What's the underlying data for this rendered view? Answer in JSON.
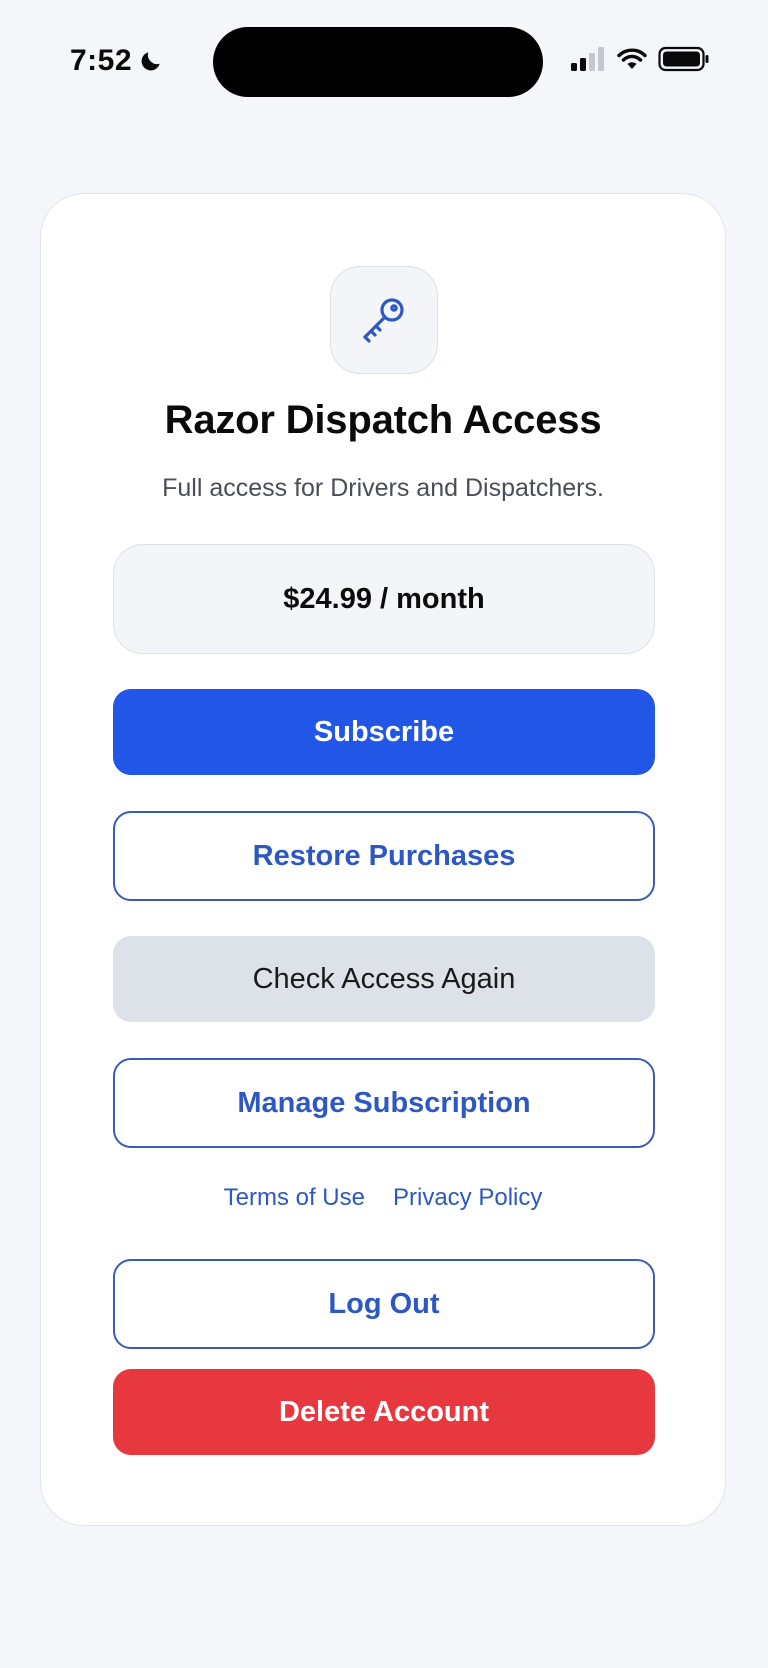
{
  "status_bar": {
    "time": "7:52",
    "icons": [
      "moon-icon",
      "signal-icon",
      "wifi-icon",
      "battery-icon"
    ]
  },
  "card": {
    "icon": "key-icon",
    "title": "Razor Dispatch Access",
    "subtitle": "Full access for Drivers and Dispatchers.",
    "price": "$24.99 / month",
    "buttons": {
      "subscribe": "Subscribe",
      "restore": "Restore Purchases",
      "check_access": "Check Access Again",
      "manage": "Manage Subscription",
      "logout": "Log Out",
      "delete": "Delete Account"
    },
    "links": {
      "terms": "Terms of Use",
      "privacy": "Privacy Policy"
    }
  },
  "colors": {
    "primary_blue": "#2156e6",
    "outline_blue": "#2d58c4",
    "danger_red": "#e8383f",
    "neutral_button": "#dde1e8",
    "background": "#f4f6f9"
  }
}
